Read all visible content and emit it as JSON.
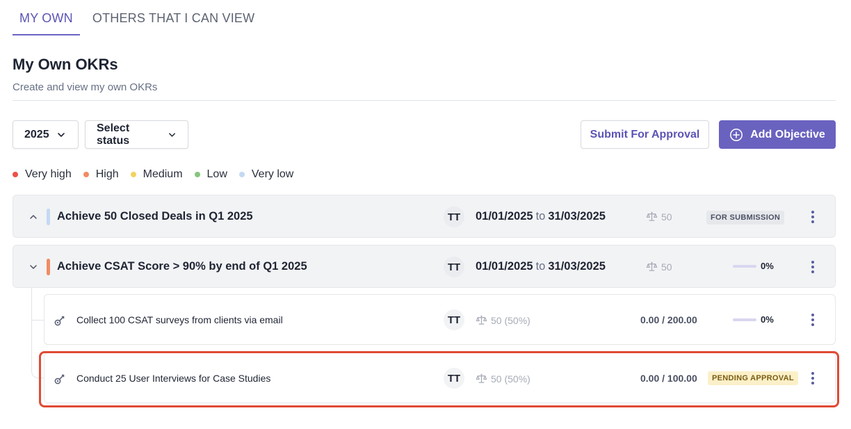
{
  "tabs": [
    {
      "label": "MY OWN",
      "active": true
    },
    {
      "label": "OTHERS THAT I CAN VIEW",
      "active": false
    }
  ],
  "header": {
    "title": "My Own OKRs",
    "subtitle": "Create and view my own OKRs"
  },
  "filters": {
    "year": "2025",
    "status": "Select status"
  },
  "actions": {
    "submit_label": "Submit For Approval",
    "add_label": "Add Objective"
  },
  "legend": [
    {
      "label": "Very high",
      "color": "#e9524a"
    },
    {
      "label": "High",
      "color": "#f08c63"
    },
    {
      "label": "Medium",
      "color": "#f2d262"
    },
    {
      "label": "Low",
      "color": "#86c57e"
    },
    {
      "label": "Very low",
      "color": "#c4d9f2"
    }
  ],
  "objectives": [
    {
      "title": "Achieve 50 Closed Deals in Q1 2025",
      "priority_color": "#c4d9f2",
      "expanded": false,
      "owner": "TT",
      "start": "01/01/2025",
      "to": "to",
      "end": "31/03/2025",
      "weight": "50",
      "status": "FOR SUBMISSION"
    },
    {
      "title": "Achieve CSAT Score > 90% by end of Q1 2025",
      "priority_color": "#f08c63",
      "expanded": true,
      "owner": "TT",
      "start": "01/01/2025",
      "to": "to",
      "end": "31/03/2025",
      "weight": "50",
      "progress": "0%",
      "progress_value": 0,
      "key_results": [
        {
          "title": "Collect 100 CSAT surveys from clients via email",
          "owner": "TT",
          "weight": "50 (50%)",
          "value": "0.00 / 200.00",
          "progress": "0%",
          "progress_value": 0
        },
        {
          "title": "Conduct 25 User Interviews for Case Studies",
          "owner": "TT",
          "weight": "50 (50%)",
          "value": "0.00 / 100.00",
          "status": "PENDING APPROVAL"
        }
      ]
    }
  ],
  "colors": {
    "accent": "#6a62bf",
    "highlight": "#e04a35"
  }
}
